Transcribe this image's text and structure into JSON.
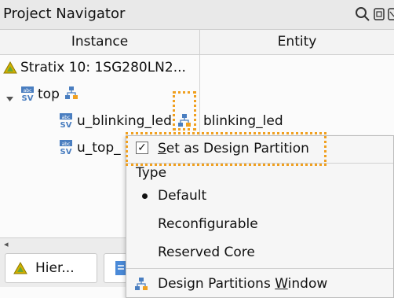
{
  "panel": {
    "title": "Project Navigator",
    "columns": {
      "instance": "Instance",
      "entity": "Entity"
    }
  },
  "rows": [
    {
      "instance": "Stratix 10: 1SG280LN2...",
      "entity": ""
    },
    {
      "instance": "top",
      "entity": ""
    },
    {
      "instance": "u_blinking_led",
      "entity": "blinking_led"
    },
    {
      "instance": "u_top_",
      "entity": ""
    }
  ],
  "tabs": {
    "hierarchy": "Hier..."
  },
  "context_menu": {
    "set_partition": {
      "prefix": "",
      "accel": "S",
      "rest": "et as Design Partition",
      "checked": true
    },
    "type_header": "Type",
    "type_options": [
      {
        "label": "Default",
        "selected": true
      },
      {
        "label": "Reconfigurable",
        "selected": false
      },
      {
        "label": "Reserved Core",
        "selected": false
      }
    ],
    "partitions_window": {
      "prefix": "Design Partitions ",
      "accel": "W",
      "rest": "indow"
    }
  },
  "colors": {
    "highlight": "#f0a020",
    "sv_icon": "#4a7ec0",
    "warning": "#d4b000"
  },
  "icons": [
    "search-icon",
    "restore-window-icon",
    "close-icon",
    "warning-triangle-icon",
    "sv-file-icon",
    "hierarchy-icon",
    "expand-arrow-icon",
    "check-icon"
  ]
}
